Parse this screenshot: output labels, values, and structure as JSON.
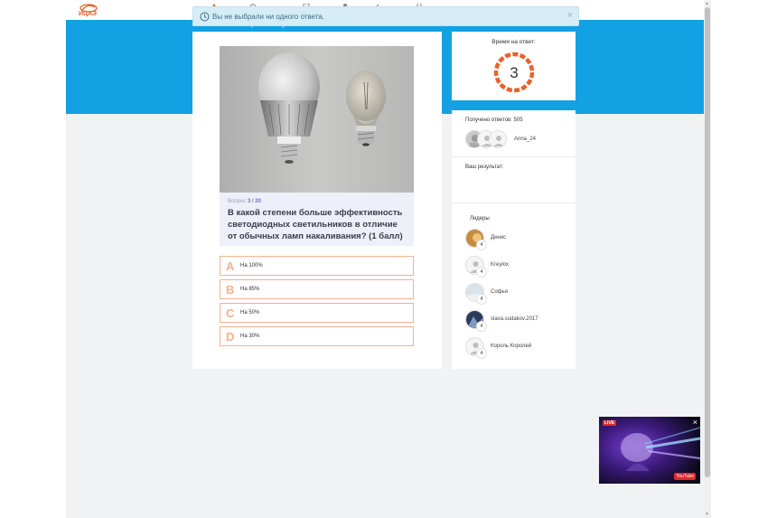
{
  "app": {
    "logo_text": "ИЦАЭ",
    "subtitle": "Атомный зачет. Электричество. Тульт"
  },
  "alert": {
    "text": "Вы не выбрали ни одного ответа.",
    "close_label": "×"
  },
  "question": {
    "counter_label": "Вопрос",
    "counter_value": "3 / 20",
    "text": "В какой степени больше эффективность светодиодных светильников в отличие от обычных ламп накаливания? (1 балл)",
    "answers": [
      {
        "letter": "A",
        "text": "На 100%"
      },
      {
        "letter": "B",
        "text": "На 85%"
      },
      {
        "letter": "C",
        "text": "На 50%"
      },
      {
        "letter": "D",
        "text": "На 30%"
      }
    ]
  },
  "timer": {
    "label": "Время на ответ:",
    "seconds": "3",
    "color": "#e8612c"
  },
  "stats": {
    "answers_received": "Получено ответов: 505",
    "recent_user": "Anna_24",
    "result_label": "Ваш результат:",
    "leaders_label": "Лидеры",
    "leaders": [
      {
        "name": "Денис",
        "score": "4"
      },
      {
        "name": "Kreylox",
        "score": "4"
      },
      {
        "name": "Софья",
        "score": "4"
      },
      {
        "name": "slava.sudakov.2017",
        "score": "4"
      },
      {
        "name": "Король Королей",
        "score": "4"
      }
    ]
  },
  "video": {
    "live_label": "LIVE",
    "close_label": "×",
    "logo": "YouTube"
  },
  "colors": {
    "brand_blue": "#12a1e2",
    "accent_orange": "#e8612c"
  }
}
